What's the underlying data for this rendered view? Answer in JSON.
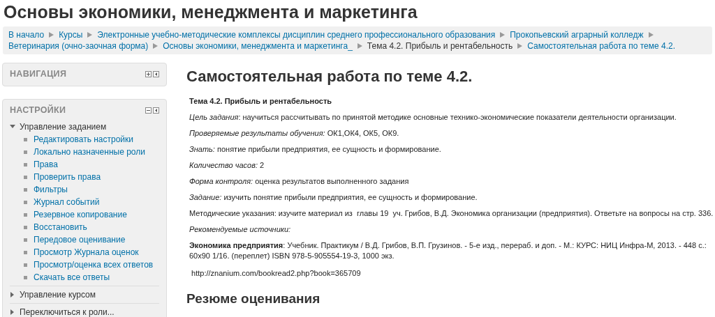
{
  "page_title": "Основы экономики, менеджмента и маркетинга",
  "breadcrumb": [
    {
      "label": "В начало",
      "link": true
    },
    {
      "label": "Курсы",
      "link": true
    },
    {
      "label": "Электронные учебно-методические комплексы дисциплин среднего профессионального образования",
      "link": true
    },
    {
      "label": "Прокопьевский аграрный колледж",
      "link": true
    },
    {
      "label": "Ветеринария (очно-заочная форма)",
      "link": true
    },
    {
      "label": "Основы экономики, менеджмента и маркетинга_",
      "link": true
    },
    {
      "label": "Тема 4.2. Прибыль и рентабельность",
      "link": false
    },
    {
      "label": "Самостоятельная работа по теме 4.2.",
      "link": true
    }
  ],
  "blocks": [
    {
      "title": "НАВИГАЦИЯ",
      "expanded": false
    },
    {
      "title": "НАСТРОЙКИ",
      "expanded": true,
      "tree": [
        {
          "label": "Управление заданием",
          "expanded": true,
          "children": [
            "Редактировать настройки",
            "Локально назначенные роли",
            "Права",
            "Проверить права",
            "Фильтры",
            "Журнал событий",
            "Резервное копирование",
            "Восстановить",
            "Передовое оценивание",
            "Просмотр Журнала оценок",
            "Просмотр/оценка всех ответов",
            "Скачать все ответы"
          ]
        },
        {
          "label": "Управление курсом",
          "expanded": false
        },
        {
          "label": "Переключиться к роли...",
          "expanded": false
        }
      ]
    }
  ],
  "main": {
    "heading": "Самостоятельная работа по теме 4.2.",
    "paragraphs": [
      {
        "kind": "title",
        "text": "Тема 4.2. Прибыль и рентабельность"
      },
      {
        "kind": "text",
        "text": "*Цель задания*: научиться рассчитывать по принятой методике основные технико-экономические показатели деятельности организации."
      },
      {
        "kind": "text",
        "text": "*Проверяемые результаты обучения:* ОК1,ОК4, ОК5, ОК9."
      },
      {
        "kind": "text",
        "text": "*Знать:* понятие прибыли предприятия, ее сущность и формирование."
      },
      {
        "kind": "text",
        "text": "*Количество часов:* 2"
      },
      {
        "kind": "text",
        "text": "*Форма контроля:* оценка результатов выполненного задания"
      },
      {
        "kind": "text",
        "text": "*Задание:* изучить понятие прибыли предприятия, ее сущность и формирование."
      },
      {
        "kind": "text",
        "text": "Методические указания: изучите материал из  главы 19  уч. Грибов, В.Д. Экономика организации (предприятия). Ответьте на вопросы на стр. 336."
      },
      {
        "kind": "text",
        "text": "*Рекомендуемые источники:*"
      },
      {
        "kind": "text",
        "text": "**Экономика предприятия**: Учебник. Практикум / В.Д. Грибов, В.П. Грузинов. - 5-е изд., перераб. и доп. - М.: КУРС: НИЦ Инфра-М, 2013. - 448 с.: 60х90 1/16. (переплет) ISBN 978-5-905554-19-3, 1000 экз."
      },
      {
        "kind": "text",
        "text": " http://znanium.com/bookread2.php?book=365709"
      }
    ],
    "subheading": "Резюме оценивания"
  }
}
